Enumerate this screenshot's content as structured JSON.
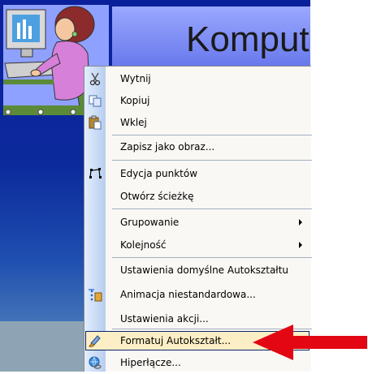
{
  "slide": {
    "title": "Kompute"
  },
  "colors": {
    "menu_highlight": "#fdefc5",
    "pointer_arrow": "#e30613"
  },
  "context_menu": {
    "items": [
      {
        "label": "Wytnij",
        "icon": "scissors-icon"
      },
      {
        "label": "Kopiuj",
        "icon": "copy-icon"
      },
      {
        "label": "Wklej",
        "icon": "paste-icon"
      },
      {
        "label": "Zapisz jako obraz...",
        "icon": ""
      },
      {
        "label": "Edycja punktów",
        "icon": "edit-points-icon"
      },
      {
        "label": "Otwórz ścieżkę",
        "icon": ""
      },
      {
        "label": "Grupowanie",
        "icon": "",
        "submenu": true
      },
      {
        "label": "Kolejność",
        "icon": "",
        "submenu": true
      },
      {
        "label": "Ustawienia domyślne Autokształtu",
        "icon": ""
      },
      {
        "label": "Animacja niestandardowa...",
        "icon": "animation-icon"
      },
      {
        "label": "Ustawienia akcji...",
        "icon": ""
      },
      {
        "label": "Formatuj Autokształt...",
        "icon": "format-shape-icon",
        "highlighted": true
      },
      {
        "label": "Hiperłącze...",
        "icon": "hyperlink-icon"
      }
    ]
  }
}
